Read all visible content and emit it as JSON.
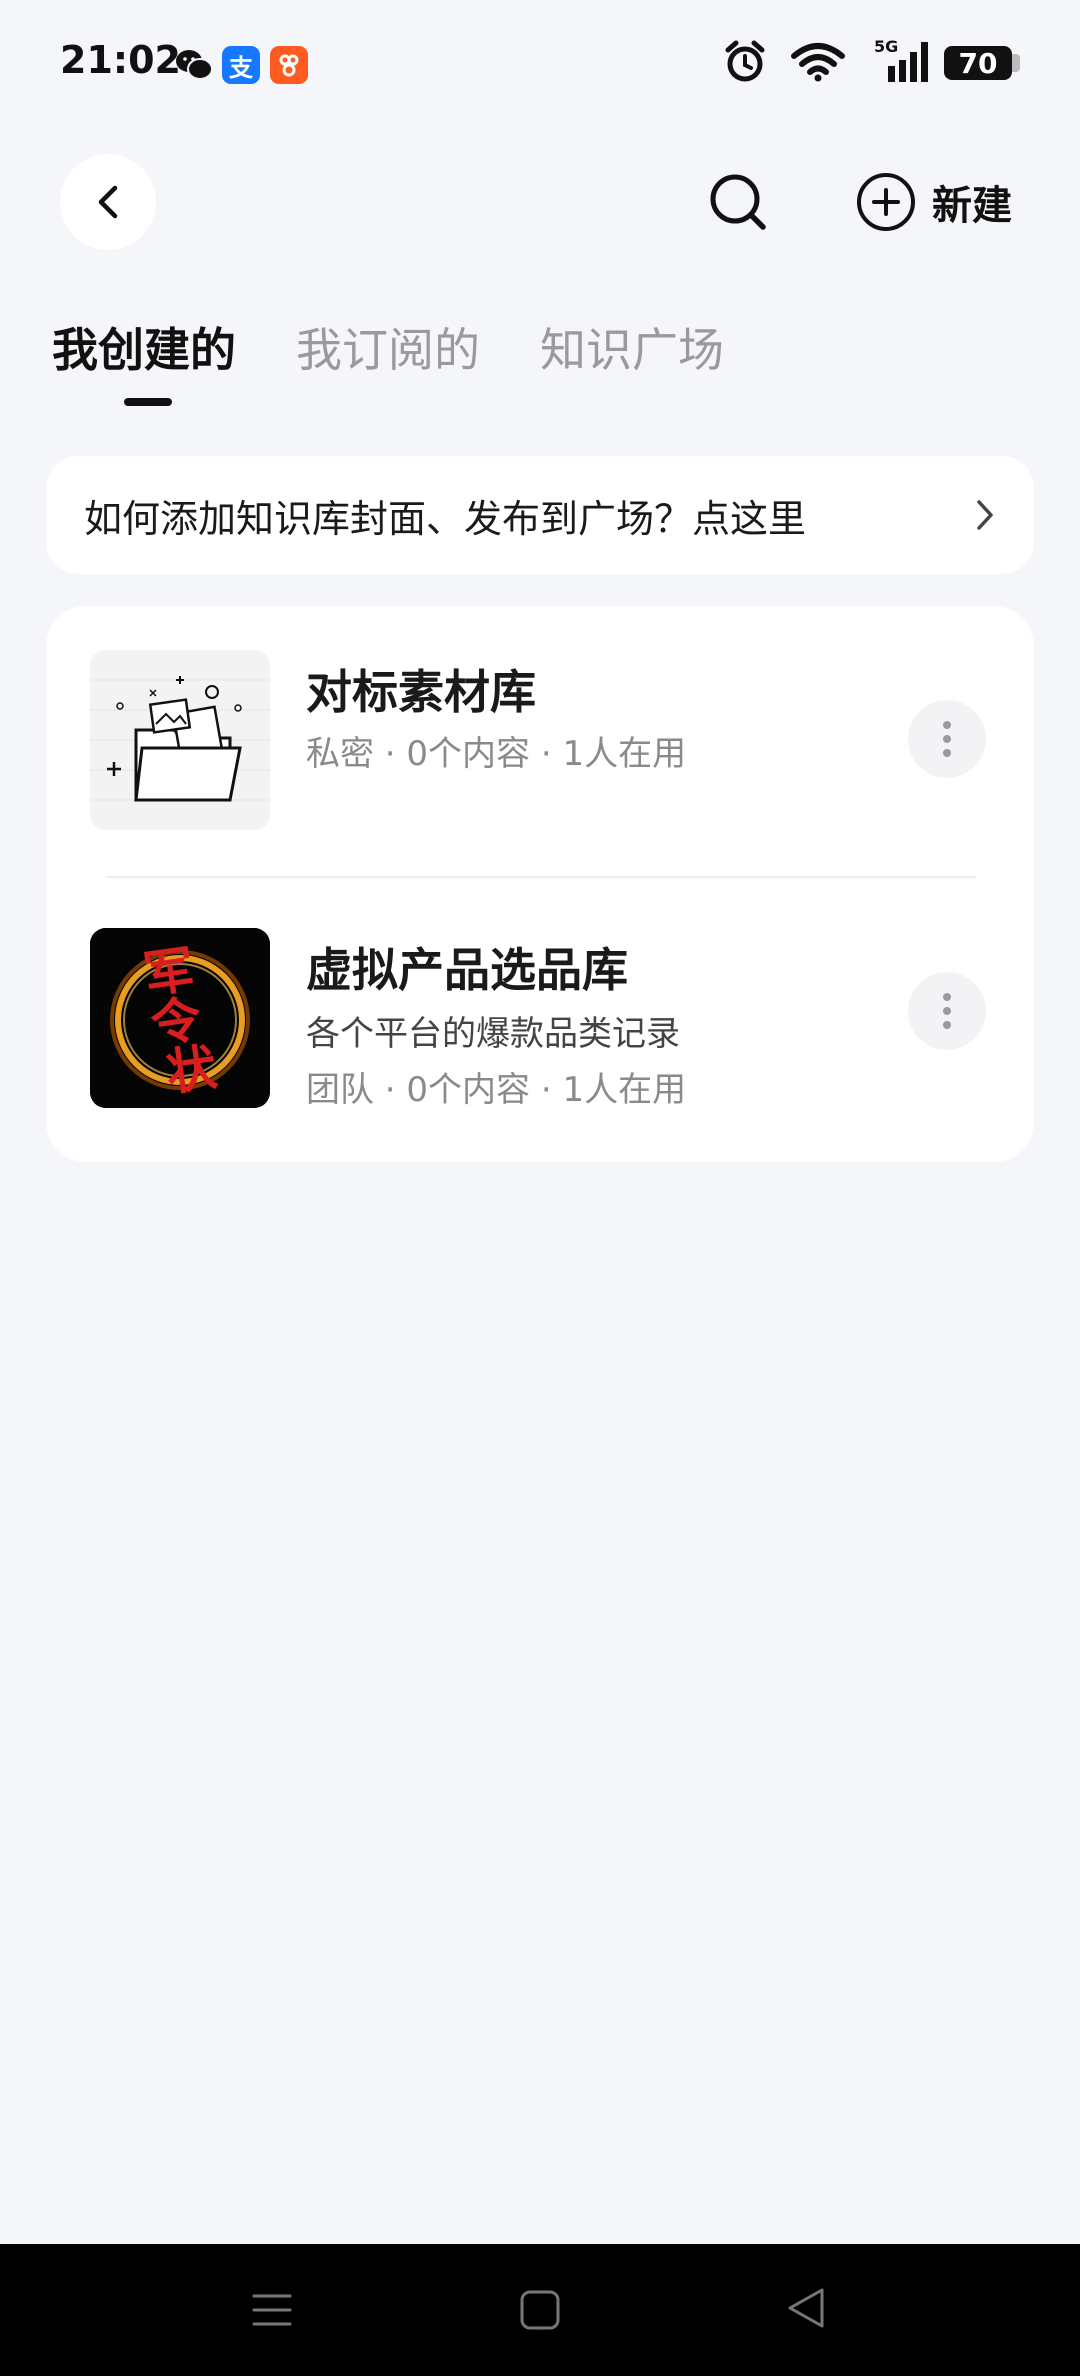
{
  "status_bar": {
    "time": "21:02",
    "network": "5G",
    "battery": "70",
    "app_icons": [
      "wechat-icon",
      "alipay-icon",
      "taobao-icon"
    ]
  },
  "header": {
    "new_label": "新建"
  },
  "tabs": [
    {
      "label": "我创建的",
      "active": true
    },
    {
      "label": "我订阅的",
      "active": false
    },
    {
      "label": "知识广场",
      "active": false
    }
  ],
  "help_banner": {
    "text": "如何添加知识库封面、发布到广场？点这里"
  },
  "libraries": [
    {
      "title": "对标素材库",
      "description": "",
      "meta": "私密 · 0个内容 · 1人在用",
      "cover": "folder-sketch-cover"
    },
    {
      "title": "虚拟产品选品库",
      "description": "各个平台的爆款品类记录",
      "meta": "团队 · 0个内容 · 1人在用",
      "cover": "red-calligraphy-cover",
      "cover_text": "军令状"
    }
  ],
  "colors": {
    "background": "#f5f6fa",
    "card": "#ffffff",
    "text_primary": "#1a1a1a",
    "text_secondary": "#8a8a8e",
    "tab_inactive": "#9a9a9e",
    "cover_red": "#d81e1e",
    "cover_glow": "#f5a623"
  }
}
